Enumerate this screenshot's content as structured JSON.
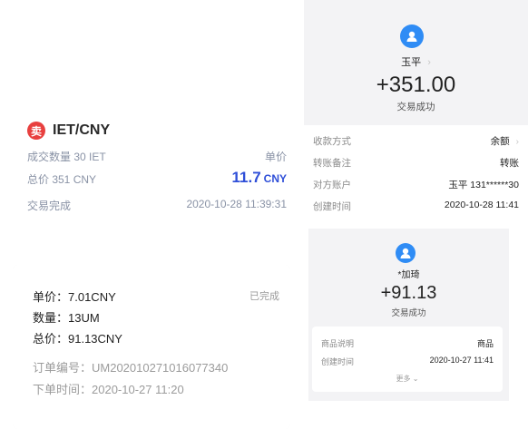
{
  "trade": {
    "badge": "卖",
    "pair": "IET/CNY",
    "qty_label": "成交数量 30 IET",
    "unit_price_label": "单价",
    "total_label": "总价 351 CNY",
    "price_value": "11.7",
    "price_unit": "CNY",
    "status": "交易完成",
    "datetime": "2020-10-28 11:39:31"
  },
  "transfer": {
    "name": "玉平",
    "amount": "+351.00",
    "status": "交易成功",
    "rows": [
      {
        "label": "收款方式",
        "value": "余额"
      },
      {
        "label": "转账备注",
        "value": "转账"
      },
      {
        "label": "对方账户",
        "value": "玉平 131******30"
      },
      {
        "label": "创建时间",
        "value": "2020-10-28 11:41"
      }
    ],
    "accent": "#2f8cf5"
  },
  "order": {
    "unit_price": "单价：7.01CNY",
    "status": "已完成",
    "quantity": "数量：13UM",
    "total": "总价：91.13CNY",
    "order_no": "订单编号：UM202010271016077340",
    "order_time": "下单时间：2020-10-27 11:20"
  },
  "payment": {
    "name": "*加琦",
    "amount": "+91.13",
    "status": "交易成功",
    "rows": [
      {
        "label": "商品说明",
        "value": "商品"
      },
      {
        "label": "创建时间",
        "value": "2020-10-27 11:41"
      }
    ],
    "more": "更多"
  }
}
